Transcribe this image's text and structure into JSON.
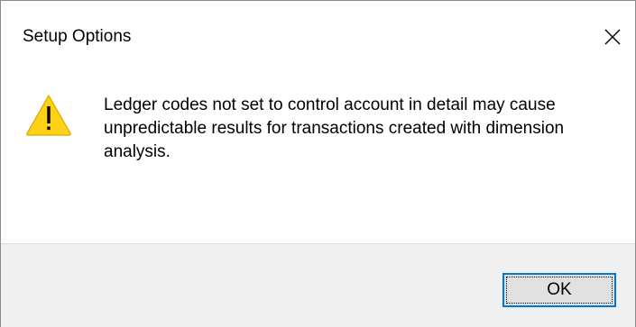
{
  "window": {
    "title": "Setup Options",
    "close_icon": "close-icon"
  },
  "message": {
    "icon": "warning-icon",
    "text": "Ledger codes not set to control account in detail may cause unpredictable results for transactions created with dimension analysis."
  },
  "buttons": {
    "ok_label": "OK"
  },
  "colors": {
    "warning_fill": "#fcd116",
    "focus_border": "#0078d7",
    "footer_bg": "#f0f0f0",
    "button_bg": "#e1e1e1"
  }
}
